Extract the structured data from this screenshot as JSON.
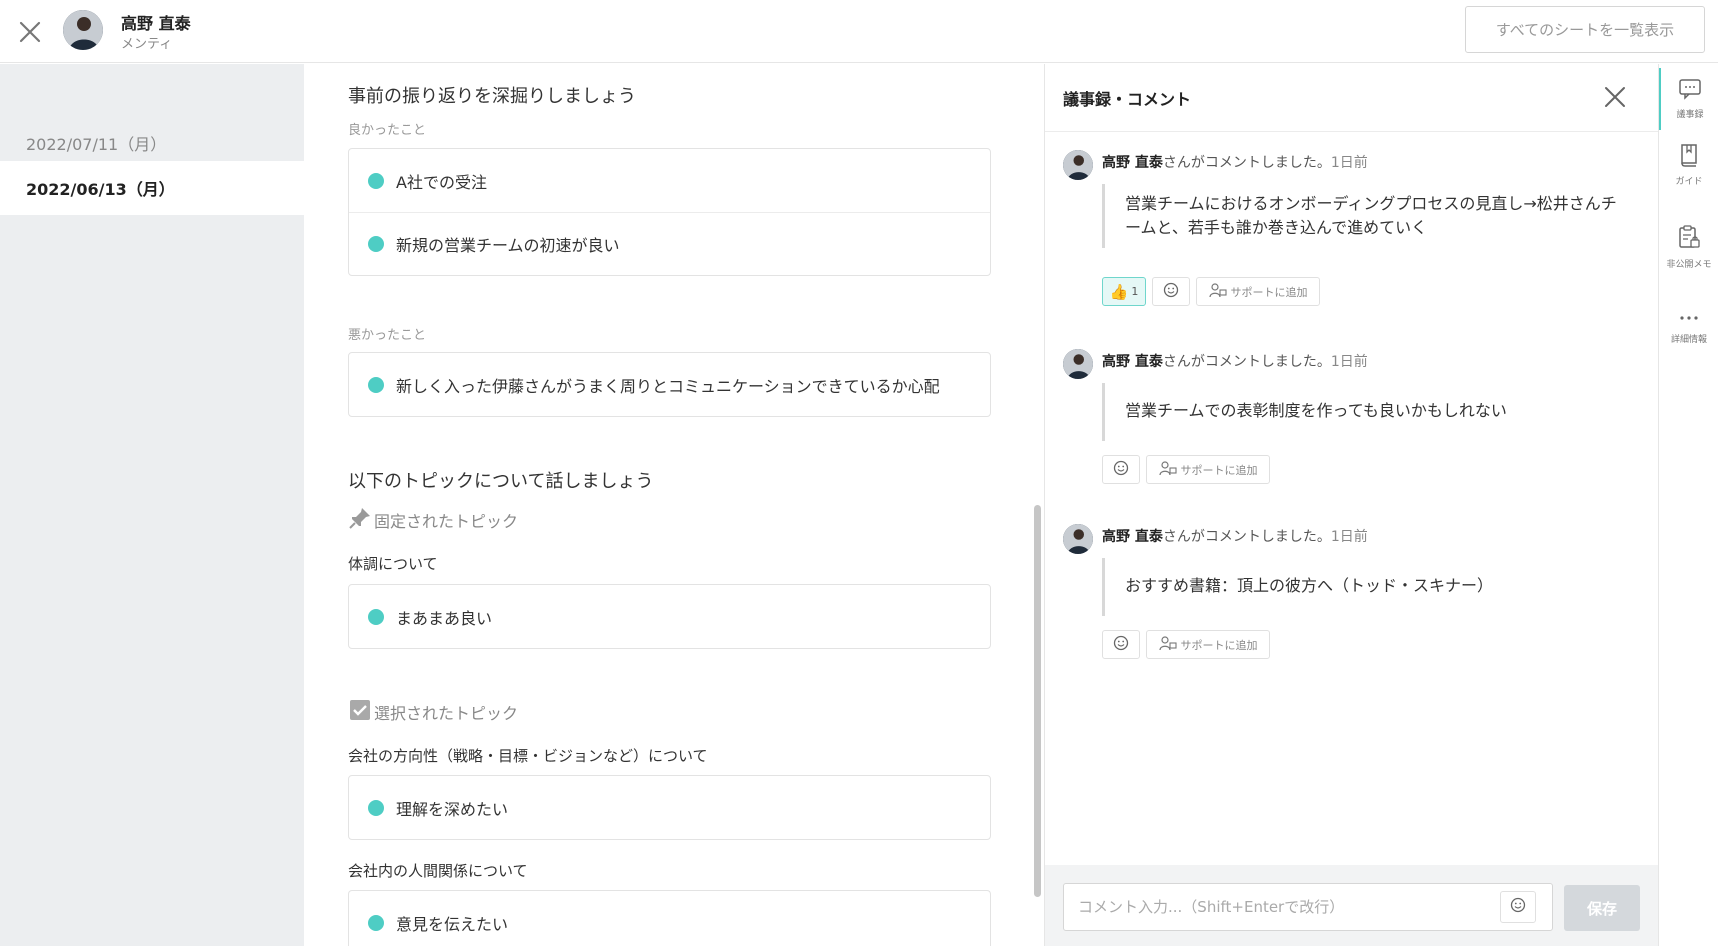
{
  "header": {
    "user_name": "高野 直泰",
    "user_role": "メンティ",
    "all_sheets_label": "すべてのシートを一覧表示"
  },
  "sidebar": {
    "dates": [
      {
        "label": "2022/07/11（月）",
        "selected": false
      },
      {
        "label": "2022/06/13（月）",
        "selected": true
      }
    ]
  },
  "main": {
    "reflection_title": "事前の振り返りを深掘りしましょう",
    "good_label": "良かったこと",
    "good_items": [
      "A社での受注",
      "新規の営業チームの初速が良い"
    ],
    "bad_label": "悪かったこと",
    "bad_items": [
      "新しく入った伊藤さんがうまく周りとコミュニケーションできているか心配"
    ],
    "topics_title": "以下のトピックについて話しましょう",
    "pinned_label": "固定されたトピック",
    "pinned_topics": [
      {
        "title": "体調について",
        "items": [
          "まあまあ良い"
        ]
      }
    ],
    "selected_label": "選択されたトピック",
    "selected_topics": [
      {
        "title": "会社の方向性（戦略・目標・ビジョンなど）について",
        "items": [
          "理解を深めたい"
        ]
      },
      {
        "title": "会社内の人間関係について",
        "items": [
          "意見を伝えたい"
        ]
      }
    ]
  },
  "panel": {
    "title": "議事録・コメント",
    "commented_suffix": "さんがコメントしました。",
    "support_label": "サポートに追加",
    "comments": [
      {
        "author": "高野 直泰",
        "ago": "1日前",
        "body": "営業チームにおけるオンボーディングプロセスの見直し→松井さんチームと、若手も誰か巻き込んで進めていく",
        "likes": "1"
      },
      {
        "author": "高野 直泰",
        "ago": "1日前",
        "body": "営業チームでの表彰制度を作っても良いかもしれない"
      },
      {
        "author": "高野 直泰",
        "ago": "1日前",
        "body": "おすすめ書籍：頂上の彼方へ（トッド・スキナー）"
      }
    ],
    "input_placeholder": "コメント入力...（Shift+Enterで改行）",
    "save_label": "保存"
  },
  "rail": {
    "items": [
      {
        "label": "議事録",
        "icon": "chat-icon",
        "active": true
      },
      {
        "label": "ガイド",
        "icon": "book-icon"
      },
      {
        "label": "非公開メモ",
        "icon": "private-memo-icon"
      },
      {
        "label": "詳細情報",
        "icon": "more-icon"
      }
    ]
  },
  "colors": {
    "accent": "#4ecdc4",
    "sidebar_bg": "#eceef0",
    "save_disabled": "#d4d8dc"
  }
}
